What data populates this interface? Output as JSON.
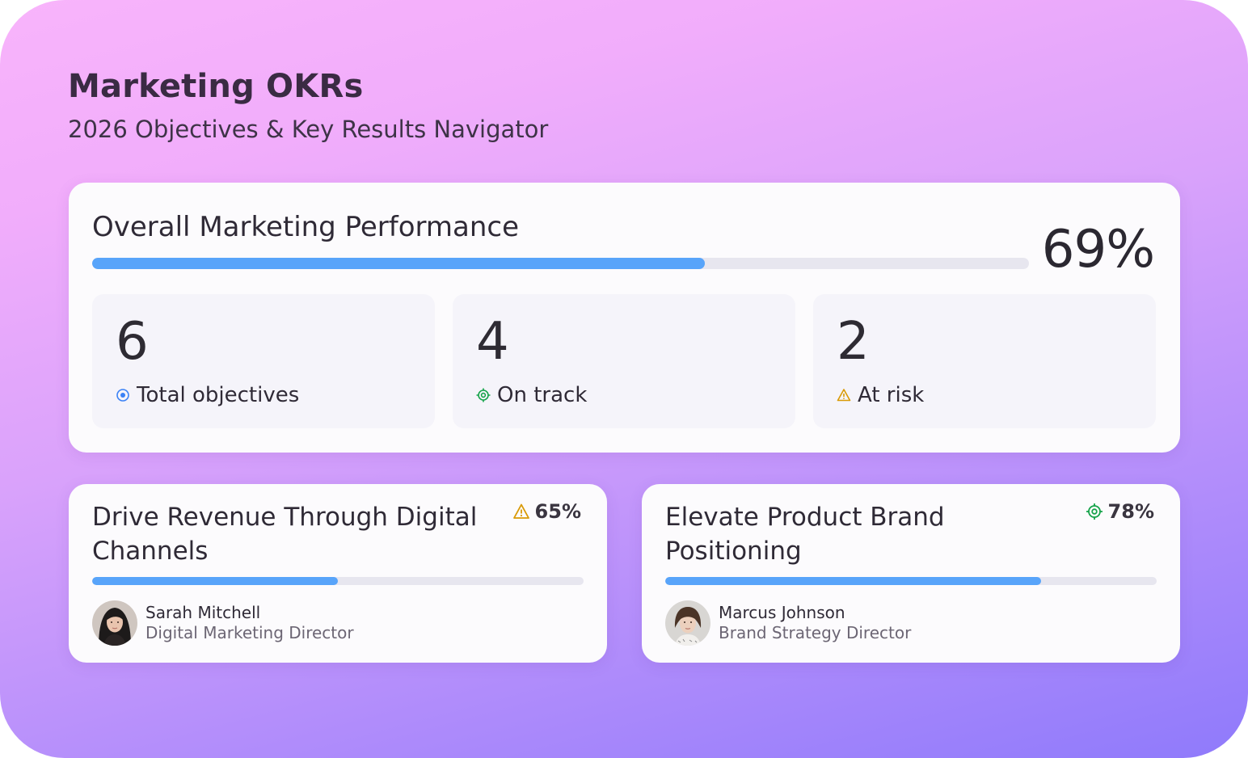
{
  "header": {
    "title": "Marketing OKRs",
    "subtitle": "2026 Objectives & Key Results Navigator"
  },
  "overall": {
    "title": "Overall Marketing Performance",
    "percent_label": "69%",
    "progress": 0.654
  },
  "stats": [
    {
      "value": "6",
      "label": "Total objectives",
      "icon": "circle-dot-icon",
      "color": "#3b82f6"
    },
    {
      "value": "4",
      "label": "On track",
      "icon": "target-icon",
      "color": "#16a34a"
    },
    {
      "value": "2",
      "label": "At risk",
      "icon": "warning-icon",
      "color": "#d99a06"
    }
  ],
  "objectives": [
    {
      "title": "Drive Revenue Through Digital Channels",
      "status_icon": "warning-icon",
      "percent_label": "65%",
      "progress": 0.5,
      "owner": {
        "name": "Sarah Mitchell",
        "role": "Digital Marketing Director"
      }
    },
    {
      "title": "Elevate Product Brand Positioning",
      "status_icon": "target-icon",
      "percent_label": "78%",
      "progress": 0.765,
      "owner": {
        "name": "Marcus Johnson",
        "role": "Brand Strategy Director"
      }
    }
  ],
  "colors": {
    "accent": "#58a4fa",
    "track": "#e7e6ef",
    "on_track": "#16a34a",
    "at_risk": "#d99a06"
  }
}
